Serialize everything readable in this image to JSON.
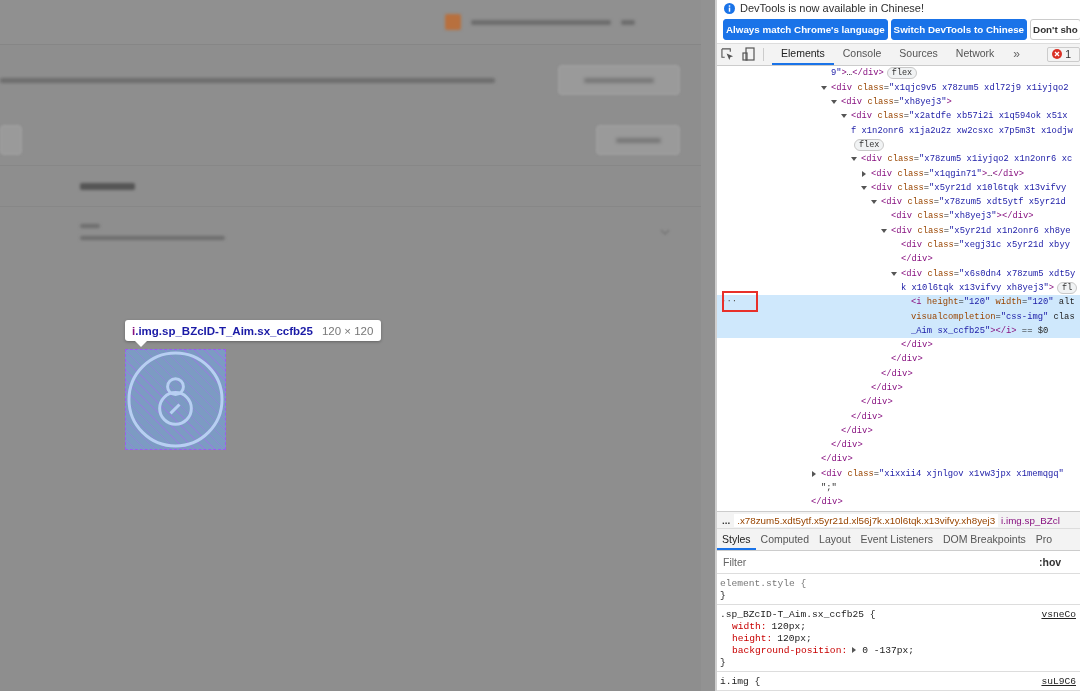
{
  "inspect_overlay": {
    "tooltip": {
      "tag": "i",
      "classes": ".img.sp_BZcID-T_Aim.sx_ccfb25",
      "size": "120 × 120"
    }
  },
  "devtools": {
    "infobar": {
      "message": "DevTools is now available in Chinese!"
    },
    "infobar_buttons": [
      {
        "label": "Always match Chrome's language",
        "kind": "primary"
      },
      {
        "label": "Switch DevTools to Chinese",
        "kind": "primary"
      },
      {
        "label": "Don't sho",
        "kind": "secondary"
      }
    ],
    "tabs": [
      {
        "label": "Elements",
        "selected": true
      },
      {
        "label": "Console",
        "selected": false
      },
      {
        "label": "Sources",
        "selected": false
      },
      {
        "label": "Network",
        "selected": false
      }
    ],
    "more_tabs": "»",
    "error_count": "1",
    "dom_tree": [
      {
        "kind": "element",
        "selected": false,
        "close": "</div>",
        "children": [
          {
            "kind": "element",
            "selected": false,
            "close": "</div>",
            "children": [
              {
                "kind": "element",
                "selected": false,
                "lines": [
                  {
                    "text": "9\">…</div>",
                    "in_value": true,
                    "badge": "flex"
                  }
                ]
              },
              {
                "kind": "element",
                "selected": false,
                "expanded": true,
                "lines": [
                  {
                    "text": "<div class=\"x1qjc9v5 x78zum5 xdl72j9 x1iyjqo2"
                  }
                ],
                "close": "</div>",
                "children": [
                  {
                    "kind": "element",
                    "selected": false,
                    "expanded": true,
                    "lines": [
                      {
                        "text": "<div class=\"xh8yej3\">"
                      }
                    ],
                    "close": "</div>",
                    "children": [
                      {
                        "kind": "element",
                        "selected": false,
                        "expanded": true,
                        "lines": [
                          {
                            "text": "<div class=\"x2atdfe xb57i2i x1q594ok x51x"
                          },
                          {
                            "text": "f x1n2onr6 x1ja2u2z xw2csxc x7p5m3t x1odjw",
                            "in_value": true
                          },
                          {
                            "badge": "flex"
                          }
                        ],
                        "close": "</div>",
                        "children": [
                          {
                            "kind": "element",
                            "selected": false,
                            "expanded": true,
                            "lines": [
                              {
                                "text": "<div class=\"x78zum5 x1iyjqo2 x1n2onr6 xc"
                              }
                            ],
                            "close": "</div>",
                            "children": [
                              {
                                "kind": "element",
                                "selected": false,
                                "expanded": false,
                                "lines": [
                                  {
                                    "text": "<div class=\"x1qgin71\">…</div>"
                                  }
                                ]
                              },
                              {
                                "kind": "element",
                                "selected": false,
                                "expanded": true,
                                "lines": [
                                  {
                                    "text": "<div class=\"x5yr21d x10l6tqk x13vifvy"
                                  }
                                ],
                                "close": "</div>",
                                "children": [
                                  {
                                    "kind": "element",
                                    "selected": false,
                                    "expanded": true,
                                    "lines": [
                                      {
                                        "text": "<div class=\"x78zum5 xdt5ytf x5yr21d"
                                      }
                                    ],
                                    "close": "</div>",
                                    "children": [
                                      {
                                        "kind": "element",
                                        "selected": false,
                                        "lines": [
                                          {
                                            "text": "<div class=\"xh8yej3\"></div>"
                                          }
                                        ]
                                      },
                                      {
                                        "kind": "element",
                                        "selected": false,
                                        "expanded": true,
                                        "lines": [
                                          {
                                            "text": "<div class=\"x5yr21d x1n2onr6 xh8ye"
                                          }
                                        ],
                                        "close": "</div>",
                                        "children": [
                                          {
                                            "kind": "element",
                                            "selected": false,
                                            "lines": [
                                              {
                                                "text": "<div class=\"xegj31c x5yr21d xbyy"
                                              }
                                            ],
                                            "close": "</div>"
                                          },
                                          {
                                            "kind": "element",
                                            "selected": false,
                                            "expanded": true,
                                            "lines": [
                                              {
                                                "text": "<div class=\"x6s0dn4 x78zum5 xdt5y"
                                              },
                                              {
                                                "text": "k x10l6tqk x13vifvy xh8yej3\">",
                                                "in_value": true,
                                                "badge": "fl"
                                              }
                                            ],
                                            "close": "</div>",
                                            "children": [
                                              {
                                                "kind": "element",
                                                "selected": true,
                                                "gutter": "···",
                                                "lines": [
                                                  {
                                                    "text": "<i height=\"120\" width=\"120\" alt"
                                                  },
                                                  {
                                                    "text": "visualcompletion=\"css-img\" clas"
                                                  },
                                                  {
                                                    "text": "_Aim sx_ccfb25\"></i> == $0",
                                                    "in_value": true
                                                  }
                                                ]
                                              }
                                            ]
                                          }
                                        ]
                                      }
                                    ]
                                  }
                                ]
                              }
                            ]
                          }
                        ]
                      }
                    ]
                  }
                ]
              }
            ]
          },
          {
            "kind": "element",
            "selected": false,
            "expanded": false,
            "lines": [
              {
                "text": "<div class=\"xixxii4 xjnlgov x1vw3jpx x1memqgq\""
              }
            ]
          },
          {
            "kind": "text",
            "lines": [
              {
                "text": "\";\""
              }
            ]
          }
        ]
      }
    ],
    "breadcrumbs": {
      "ellipsis": "...",
      "items": [
        {
          "label": ".x78zum5.xdt5ytf.x5yr21d.xl56j7k.x10l6tqk.x13vifvy.xh8yej3",
          "selected": true
        },
        {
          "label": "i.img.sp_BZcl",
          "selected": false
        }
      ]
    },
    "sidebar_tabs": [
      {
        "label": "Styles",
        "selected": true
      },
      {
        "label": "Computed",
        "selected": false
      },
      {
        "label": "Layout",
        "selected": false
      },
      {
        "label": "Event Listeners",
        "selected": false
      },
      {
        "label": "DOM Breakpoints",
        "selected": false
      },
      {
        "label": "Pro",
        "selected": false
      }
    ],
    "filter": {
      "placeholder": "Filter"
    },
    "hov_toggle": ":hov",
    "rules": [
      {
        "selector": "element.style {",
        "close": "}"
      },
      {
        "selector": ".sp_BZcID-T_Aim.sx_ccfb25 {",
        "source": "vsneCo",
        "close": "}",
        "declarations": [
          {
            "property": "width:",
            "value": "120px;"
          },
          {
            "property": "height:",
            "value": "120px;"
          },
          {
            "property": "background-position:",
            "value": "0 -137px;",
            "expandable": true
          }
        ]
      },
      {
        "selector": "i.img {",
        "source": "suL9C6"
      }
    ]
  }
}
